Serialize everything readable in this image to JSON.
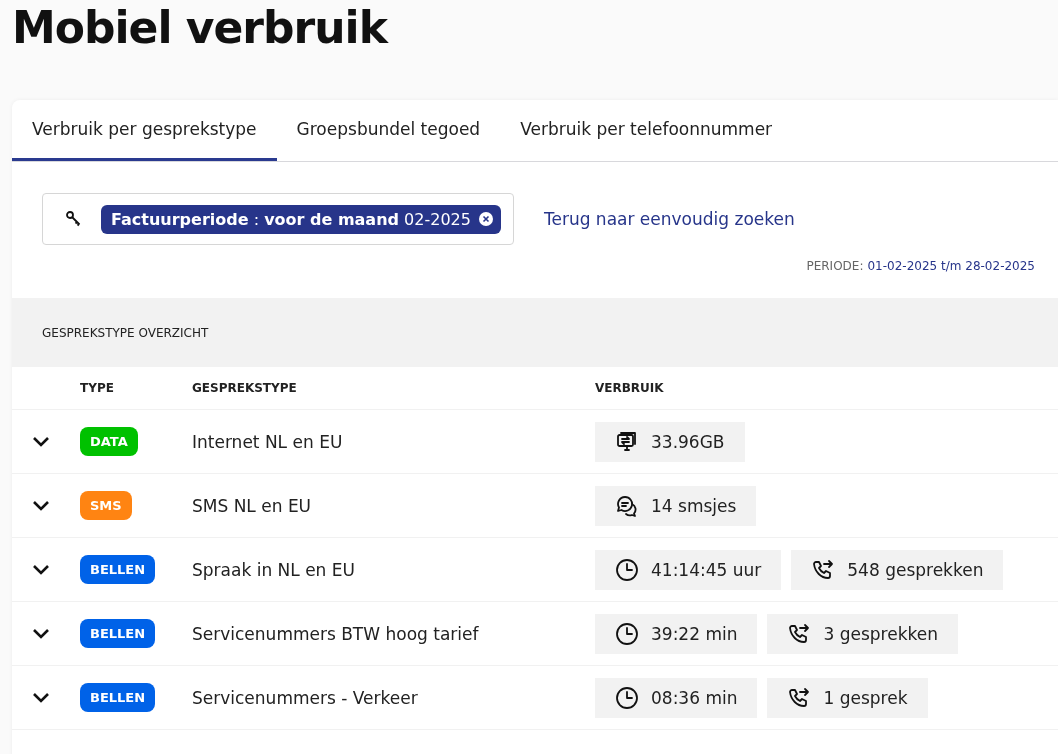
{
  "title": "Mobiel verbruik",
  "tabs": [
    {
      "label": "Verbruik per gesprekstype",
      "selected": true
    },
    {
      "label": "Groepsbundel tegoed",
      "selected": false
    },
    {
      "label": "Verbruik per telefoonnummer",
      "selected": false
    }
  ],
  "search": {
    "filter": "**Factuurperiode** : **voor de maand** 02-2025",
    "link": "Terug naar eenvoudig zoeken"
  },
  "period": {
    "label": "PERIODE:",
    "value": "01-02-2025 t/m 28-02-2025"
  },
  "section_title": "GESPREKSTYPE OVERZICHT",
  "table": {
    "columns": [
      "TYPE",
      "GESPREKSTYPE",
      "VERBRUIK"
    ],
    "rows": [
      {
        "expanded": false,
        "type": "DATA",
        "color": "#00c100",
        "name": "Internet NL en EU",
        "usage": [
          {
            "kind": "data",
            "text": "33.96GB"
          }
        ]
      },
      {
        "expanded": false,
        "type": "SMS",
        "color": "#ff8412",
        "name": "SMS NL en EU",
        "usage": [
          {
            "kind": "sms",
            "text": "14 smsjes"
          }
        ]
      },
      {
        "expanded": false,
        "type": "BELLEN",
        "color": "#0062e8",
        "name": "Spraak in NL en EU",
        "usage": [
          {
            "kind": "time",
            "text": "41:14:45 uur"
          },
          {
            "kind": "calls",
            "text": "548 gesprekken"
          }
        ]
      },
      {
        "expanded": false,
        "type": "BELLEN",
        "color": "#0062e8",
        "name": "Servicenummers BTW hoog tarief",
        "usage": [
          {
            "kind": "time",
            "text": "39:22 min"
          },
          {
            "kind": "calls",
            "text": "3 gesprekken"
          }
        ]
      },
      {
        "expanded": false,
        "type": "BELLEN",
        "color": "#0062e8",
        "name": "Servicenummers - Verkeer",
        "usage": [
          {
            "kind": "time",
            "text": "08:36 min"
          },
          {
            "kind": "calls",
            "text": "1 gesprek"
          }
        ]
      }
    ]
  }
}
